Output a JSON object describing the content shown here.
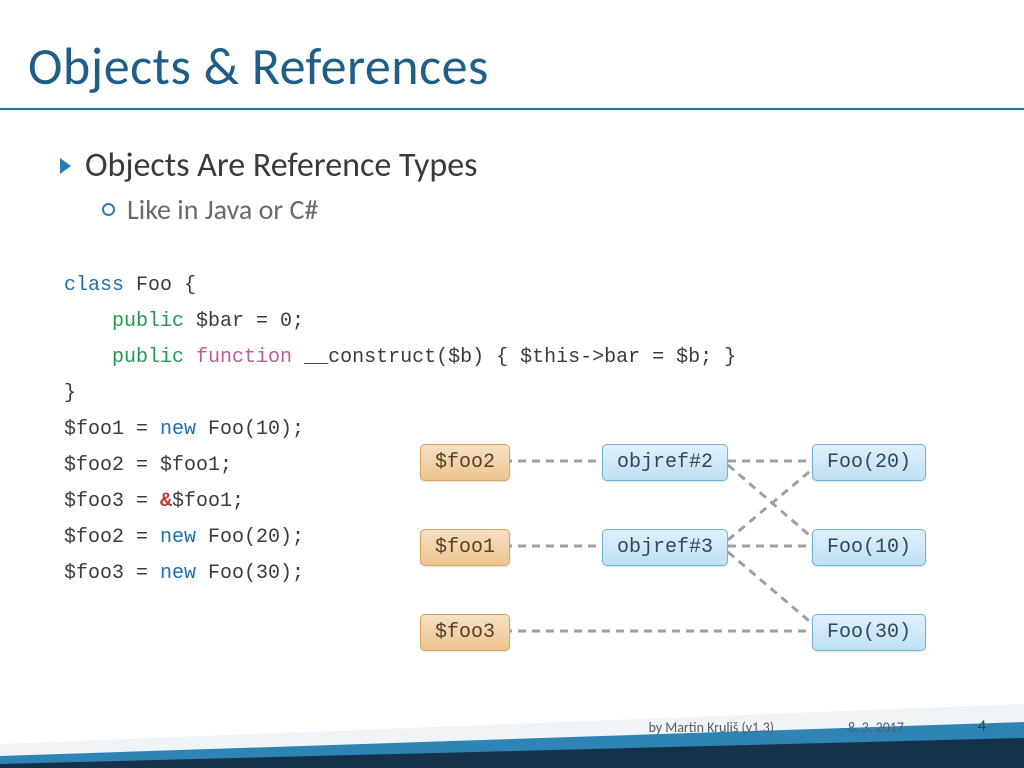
{
  "title": "Objects & References",
  "bullets": {
    "main": "Objects Are Reference Types",
    "sub": "Like in Java or C#"
  },
  "code": {
    "l1a": "class",
    "l1b": " Foo {",
    "l2a": "    ",
    "l2b": "public",
    "l2c": " $bar = 0;",
    "l3a": "    ",
    "l3b": "public",
    "l3c": " ",
    "l3d": "function",
    "l3e": " __construct($b) { $this->bar = $b; }",
    "l4": "}",
    "l5a": "$foo1 = ",
    "l5b": "new",
    "l5c": " Foo(10);",
    "l6": "$foo2 = $foo1;",
    "l7a": "$foo3 = ",
    "l7amp": "&",
    "l7b": "$foo1;",
    "l8a": "$foo2 = ",
    "l8b": "new",
    "l8c": " Foo(20);",
    "l9a": "$foo3 = ",
    "l9b": "new",
    "l9c": " Foo(30);"
  },
  "boxes": {
    "foo2": "$foo2",
    "foo1": "$foo1",
    "foo3": "$foo3",
    "ref2": "objref#2",
    "ref3": "objref#3",
    "o20": "Foo(20)",
    "o10": "Foo(10)",
    "o30": "Foo(30)"
  },
  "footer": {
    "author": "by Martin Kruliš (v1.3)",
    "date": "8. 3. 2017",
    "page": "4"
  }
}
